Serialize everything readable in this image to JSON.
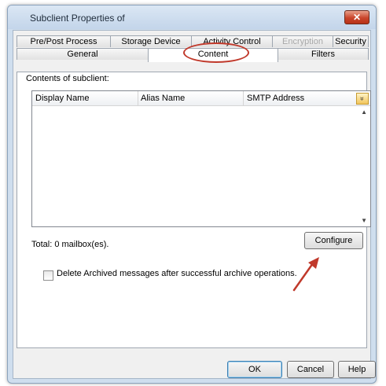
{
  "window": {
    "title": "Subclient Properties of",
    "close_glyph": "✕"
  },
  "tabs": {
    "row_back": [
      {
        "label": "Pre/Post Process",
        "state": "normal"
      },
      {
        "label": "Storage Device",
        "state": "normal"
      },
      {
        "label": "Activity Control",
        "state": "normal"
      },
      {
        "label": "Encryption",
        "state": "disabled"
      },
      {
        "label": "Security",
        "state": "normal"
      }
    ],
    "row_front": [
      {
        "label": "General",
        "state": "normal"
      },
      {
        "label": "Content",
        "state": "selected"
      },
      {
        "label": "Filters",
        "state": "normal"
      }
    ],
    "highlight_color": "#c0392b"
  },
  "content": {
    "section_label": "Contents of subclient:",
    "columns": [
      "Display Name",
      "Alias Name",
      "SMTP Address"
    ],
    "rows": [],
    "header_button_icon": "chevron-double-down-icon",
    "header_button_glyph": "»",
    "total_text": "Total: 0 mailbox(es).",
    "configure_label": "Configure",
    "delete_checkbox_label": "Delete Archived messages after successful archive operations.",
    "delete_checkbox_checked": false,
    "annotation_arrow_color": "#c0392b"
  },
  "footer": {
    "ok_label": "OK",
    "cancel_label": "Cancel",
    "help_label": "Help"
  }
}
